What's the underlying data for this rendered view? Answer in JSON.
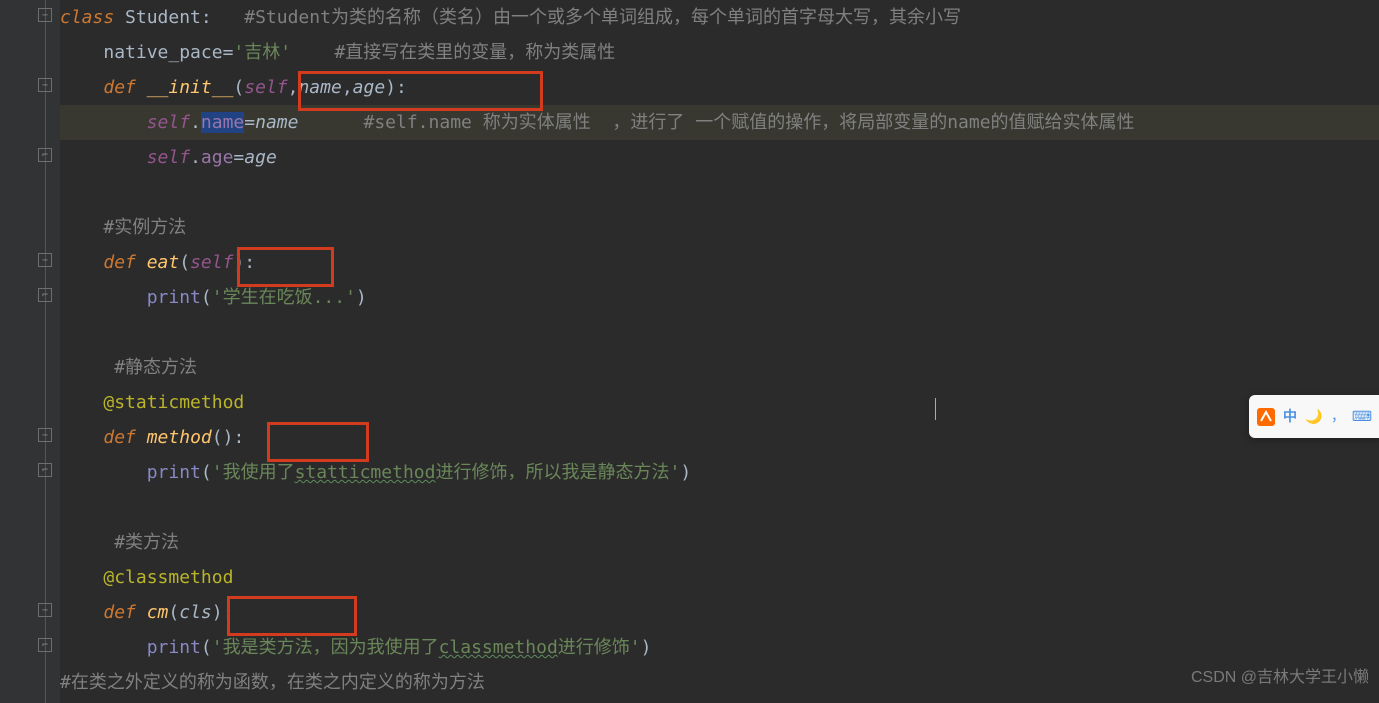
{
  "code": {
    "line1": {
      "kw": "class ",
      "name": "Student",
      "colon": ":   ",
      "comment": "#Student为类的名称（类名）由一个或多个单词组成，每个单词的首字母大写，其余小写"
    },
    "line2": {
      "indent": "    ",
      "var": "native_pace",
      "eq": "=",
      "str": "'吉林'",
      "space": "    ",
      "comment": "#直接写在类里的变量，称为类属性"
    },
    "line3": {
      "indent": "    ",
      "kw": "def ",
      "fn": "__init__",
      "open": "(",
      "p1": "self",
      "c1": ",",
      "p2": "name",
      "c2": ",",
      "p3": "age",
      "close": ")",
      "colon": ":"
    },
    "line4": {
      "indent": "        ",
      "self": "self",
      "dot": ".",
      "attr": "name",
      "eq": "=",
      "val": "name",
      "space": "      ",
      "comment": "#self.name 称为实体属性  ，进行了 一个赋值的操作，将局部变量的name的值赋给实体属性"
    },
    "line5": {
      "indent": "        ",
      "self": "self",
      "dot": ".",
      "attr": "age",
      "eq": "=",
      "val": "age"
    },
    "line7": {
      "indent": "    ",
      "comment": "#实例方法"
    },
    "line8": {
      "indent": "    ",
      "kw": "def ",
      "fn": "eat",
      "open": "(",
      "p1": "self",
      "close": ")",
      "colon": ":"
    },
    "line9": {
      "indent": "        ",
      "builtin": "print",
      "open": "(",
      "str": "'学生在吃饭...'",
      "close": ")"
    },
    "line11": {
      "indent": "     ",
      "comment": "#静态方法"
    },
    "line12": {
      "indent": "    ",
      "dec": "@staticmethod"
    },
    "line13": {
      "indent": "    ",
      "kw": "def ",
      "fn": "method",
      "open": "(",
      "close": ")",
      "colon": ":"
    },
    "line14": {
      "indent": "        ",
      "builtin": "print",
      "open": "(",
      "str1": "'我使用了",
      "typo": "statticmethod",
      "str2": "进行修饰，所以我是静态方法'",
      "close": ")"
    },
    "line16": {
      "indent": "     ",
      "comment": "#类方法"
    },
    "line17": {
      "indent": "    ",
      "dec": "@classmethod"
    },
    "line18": {
      "indent": "    ",
      "kw": "def ",
      "fn": "cm",
      "open": "(",
      "p1": "cls",
      "close": ")",
      "colon": ":"
    },
    "line19": {
      "indent": "        ",
      "builtin": "print",
      "open": "(",
      "str1": "'我是类方法，因为我使用了",
      "typo": "classmethod",
      "str2": "进行修饰'",
      "close": ")"
    },
    "line20": {
      "comment": "#在类之外定义的称为函数，在类之内定义的称为方法"
    }
  },
  "ime": {
    "lang": "中",
    "punct": "，"
  },
  "watermark": "CSDN @吉林大学王小懒"
}
